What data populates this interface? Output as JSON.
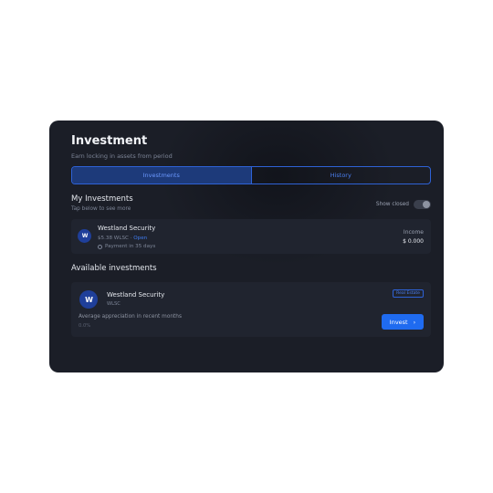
{
  "header": {
    "title": "Investment",
    "subtitle": "Earn locking in assets from period"
  },
  "tabs": [
    {
      "label": "Investments",
      "active": true
    },
    {
      "label": "History",
      "active": false
    }
  ],
  "my_investments": {
    "title": "My Investments",
    "subtitle": "Tap below to see more",
    "toggle_label": "Show closed",
    "toggle_on": false,
    "item": {
      "name": "Westland Security",
      "amount": "$5.38 WLSC",
      "link": "Open",
      "payment": "Payment in 35 days",
      "income_label": "Income",
      "income_value": "$ 0.000"
    }
  },
  "available": {
    "title": "Available investments",
    "item": {
      "name": "Westland Security",
      "ticker": "WLSC",
      "badge": "Real Estate",
      "description": "Average appreciation in recent months",
      "percent": "0.0%",
      "button_label": "Invest",
      "button_arrow": "›"
    }
  },
  "colors": {
    "background": "#1b1e27",
    "accent": "#1f6bf0",
    "panel": "#20242f"
  },
  "icons": {
    "logo": "westland-logo-icon",
    "clock": "clock-icon",
    "arrow": "chevron-right-icon"
  }
}
